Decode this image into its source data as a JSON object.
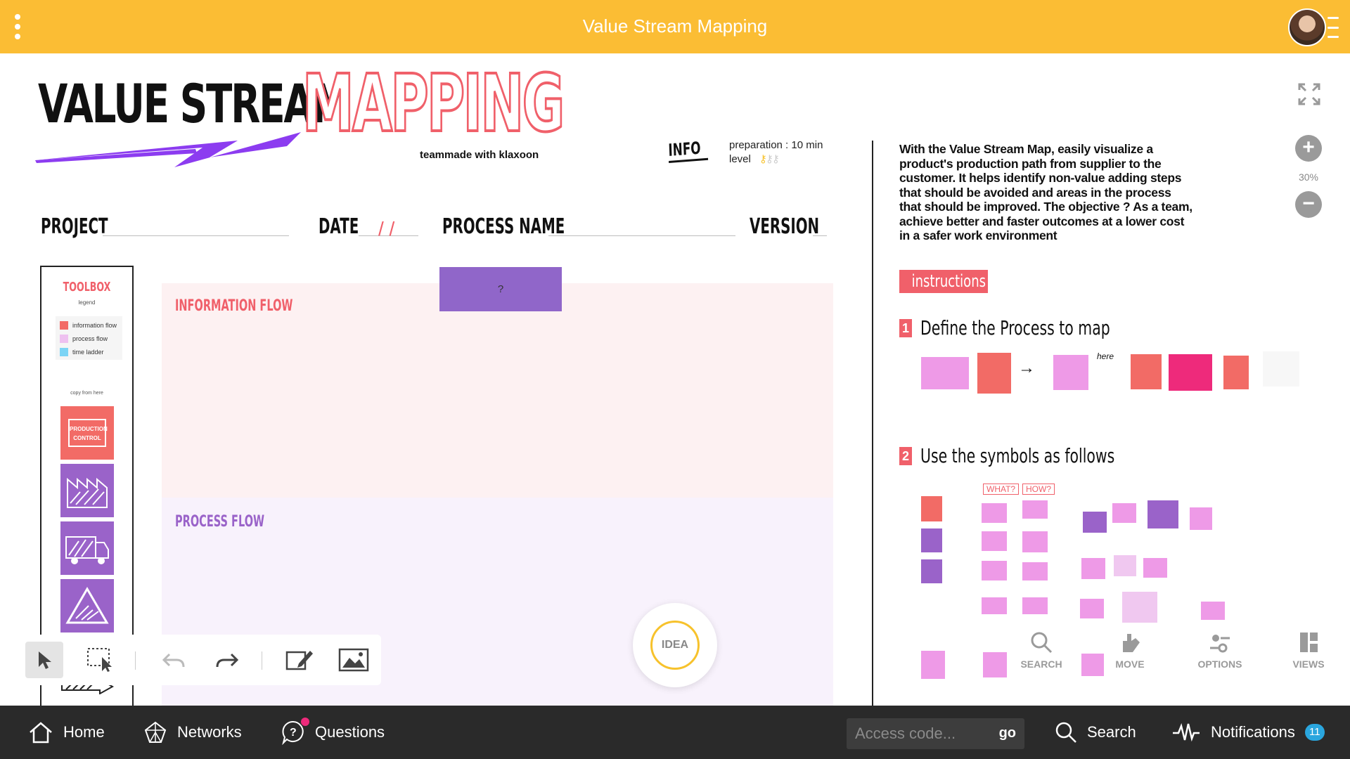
{
  "topbar": {
    "title": "Value Stream Mapping"
  },
  "logo": {
    "value_stream": "VALUE STREAM",
    "mapping": "MAPPING",
    "teammade": "teammade with klaxoon"
  },
  "info": {
    "tag": "INFO",
    "preparation": "preparation : 10 min",
    "level": "level"
  },
  "fields": {
    "project": "PROJECT",
    "date": "DATE",
    "date_slashes": "/ /",
    "process_name": "PROCESS NAME",
    "version": "VERSION"
  },
  "toolbox": {
    "title": "TOOLBOX",
    "legend": "legend",
    "legend_items": [
      {
        "label": "information flow",
        "color": "#f26b66"
      },
      {
        "label": "process flow",
        "color": "#eec1f0"
      },
      {
        "label": "time ladder",
        "color": "#7cd4f5"
      }
    ],
    "copy_from": "copy from here",
    "production_control": "PRODUCTION CONTROL"
  },
  "zones": {
    "information_flow": "INFORMATION FLOW",
    "process_flow": "PROCESS FLOW",
    "sticky_text": "?"
  },
  "description": "With the Value Stream Map, easily visualize a product's production path from supplier to the customer. It helps identify non-value adding steps that should be avoided and areas in the process that should be improved. The objective ? As a team, achieve better and faster outcomes at a lower cost in a safer work environment",
  "instructions": {
    "badge": "instructions",
    "steps": [
      {
        "num": "1",
        "text": "Define the Process to map"
      },
      {
        "num": "2",
        "text": "Use the symbols as follows"
      }
    ],
    "what": "WHAT?",
    "how": "HOW?",
    "here": "here"
  },
  "right_panel": {
    "zoom_level": "30%",
    "tools": [
      {
        "label": "SEARCH",
        "icon": "search-icon"
      },
      {
        "label": "MOVE",
        "icon": "move-icon"
      },
      {
        "label": "OPTIONS",
        "icon": "options-icon"
      },
      {
        "label": "VIEWS",
        "icon": "views-icon"
      }
    ]
  },
  "idea_button": "IDEA",
  "bottombar": {
    "home": "Home",
    "networks": "Networks",
    "questions": "Questions",
    "access_placeholder": "Access code...",
    "go": "go",
    "search": "Search",
    "notifications": "Notifications",
    "notifications_count": "11"
  },
  "colors": {
    "accent_yellow": "#fbbd34",
    "accent_red": "#f0606a",
    "accent_purple": "#9a63c9",
    "bottom_bar": "#2a2a2a"
  }
}
